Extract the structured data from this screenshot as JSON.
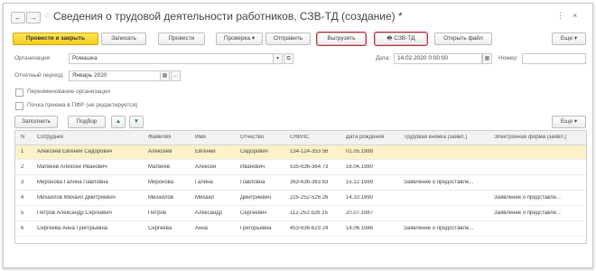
{
  "window": {
    "title": "Сведения о трудовой деятельности работников, СЗВ-ТД (создание) *",
    "nav_back": "←",
    "nav_forward": "→",
    "star": "☆",
    "more": "⋮",
    "close": "×"
  },
  "toolbar": {
    "post_close": "Провести и закрыть",
    "save": "Записать",
    "post": "Провести",
    "check": "Проверка",
    "send": "Отправить",
    "export": "Выгрузить",
    "print_szv": "СЗВ-ТД",
    "open_file": "Открыть файл",
    "more": "Еще",
    "dropdown": "▾"
  },
  "form": {
    "org_label": "Организация",
    "org_value": "Ромашка",
    "date_label": "Дата:",
    "date_value": "14.02.2020  0:00:00",
    "number_label": "Номер:",
    "number_value": "",
    "period_label": "Отчетный период:",
    "period_value": "Январь 2020",
    "rename_label": "Переименование организации",
    "pfr_label": "Почка приема в ПФР (не редактируется)"
  },
  "table_toolbar": {
    "fill": "Заполнить",
    "select": "Подбор",
    "up": "▲",
    "down": "▼",
    "more": "Еще"
  },
  "table": {
    "headers": [
      "N",
      "Сотрудник",
      "Фамилия",
      "Имя",
      "Отчество",
      "СНИЛС",
      "Дата рождения",
      "Трудовая книжка (заявл.)",
      "Электронная форма (заявл.)"
    ],
    "rows": [
      [
        "1",
        "Алексеев Евгений Сидорович",
        "Алексеев",
        "Евгений",
        "Сидорович",
        "134-124-353 56",
        "01.05.1988",
        "",
        ""
      ],
      [
        "2",
        "Матвеев Алексей Иванович",
        "Матвеев",
        "Алексей",
        "Иванович",
        "535-636-364 73",
        "16.04.1980",
        "",
        ""
      ],
      [
        "3",
        "Миронова Галина Павловна",
        "Миронова",
        "Галина",
        "Павловна",
        "363-636-363 63",
        "15.12.1989",
        "Заявление о предоставле...",
        ""
      ],
      [
        "4",
        "Михайлов Михаил Дмитриевич",
        "Михайлов",
        "Михаил",
        "Дмитриевич",
        "225-252-526 26",
        "14.10.1990",
        "",
        "Заявление о представле..."
      ],
      [
        "5",
        "Петров Александр Сергеевич",
        "Петров",
        "Александр",
        "Сергеевич",
        "112-252-526 25",
        "20.07.1987",
        "",
        "Заявление о представле..."
      ],
      [
        "6",
        "Сергеева Анна Григорьевна",
        "Сергеева",
        "Анна",
        "Григорьевна",
        "453-636-623 24",
        "14.06.1986",
        "Заявление о предоставле...",
        ""
      ]
    ]
  },
  "colors": {
    "primary": "#f4cc1c",
    "highlight": "#d3263a",
    "selected_row": "#fdf1c8"
  }
}
